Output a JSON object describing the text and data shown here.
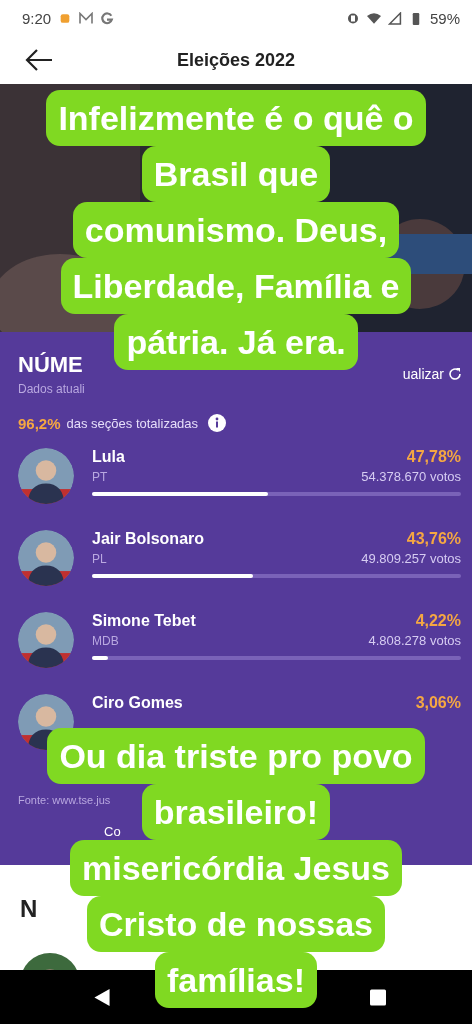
{
  "status_bar": {
    "time": "9:20",
    "battery": "59%"
  },
  "app_bar": {
    "title": "Eleições 2022"
  },
  "results": {
    "title": "NÚME",
    "subtitle": "Dados atuali",
    "refresh": "ualizar",
    "progress_value": "96,2%",
    "progress_label": "das seções totalizadas",
    "candidates": [
      {
        "name": "Lula",
        "party": "PT",
        "percent": "47,78%",
        "votes": "54.378.670 votos",
        "level": 0.4778
      },
      {
        "name": "Jair Bolsonaro",
        "party": "PL",
        "percent": "43,76%",
        "votes": "49.809.257 votos",
        "level": 0.4376
      },
      {
        "name": "Simone Tebet",
        "party": "MDB",
        "percent": "4,22%",
        "votes": "4.808.278 votos",
        "level": 0.0422
      },
      {
        "name": "Ciro Gomes",
        "percent": "3,06%"
      }
    ],
    "source": "Fonte: www.tse.jus",
    "more_button": "Co"
  },
  "news": {
    "title": "N"
  },
  "captions": [
    {
      "lines": [
        "Infelizmente é o quê o",
        "Brasil que",
        "comunismo. Deus,",
        "Liberdade, Família e",
        "pátria. Já era."
      ]
    },
    {
      "lines": [
        "Ou dia triste pro povo",
        "brasileiro!",
        "misericórdia Jesus",
        "Cristo de nossas",
        "famílias!"
      ]
    }
  ]
}
